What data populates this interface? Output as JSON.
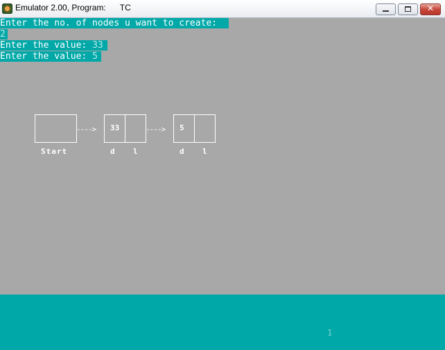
{
  "window": {
    "title": "Emulator 2.00, Program:",
    "program": "TC"
  },
  "console": {
    "line1": "Enter the no. of nodes u want to create:",
    "line2_value": "2",
    "line3_prompt": "Enter the value: ",
    "line3_value": "33",
    "line4_prompt": "Enter the value: ",
    "line4_value": "5"
  },
  "diagram": {
    "arrow": "---->",
    "start_label": "Start",
    "nodes": [
      {
        "value": "33",
        "d_label": "d",
        "l_label": "l"
      },
      {
        "value": "5",
        "d_label": "d",
        "l_label": "l"
      }
    ]
  },
  "status": {
    "page_number": "1"
  },
  "colors": {
    "background": "#a8a8a8",
    "highlight": "#00a8a8",
    "text": "#ffffff"
  },
  "icons": {
    "app": "emulator-app-icon",
    "minimize": "minimize-icon",
    "maximize": "maximize-icon",
    "close": "close-icon"
  }
}
